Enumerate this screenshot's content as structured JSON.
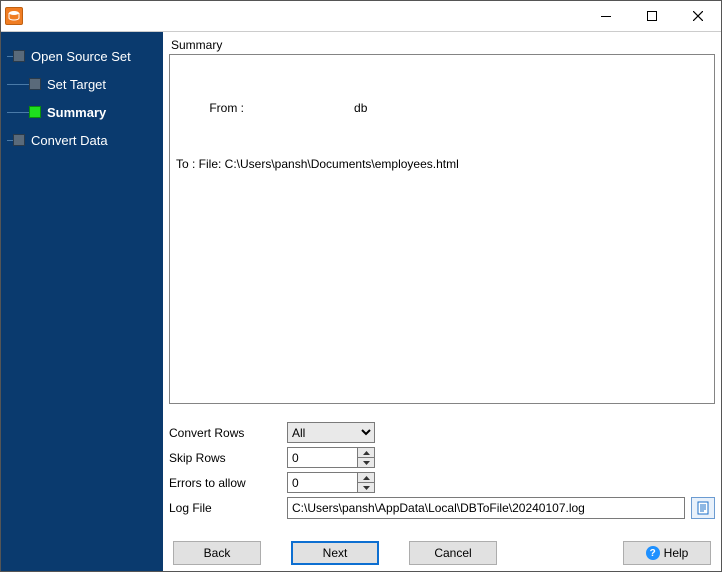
{
  "window": {
    "app_icon": "db-convert-icon"
  },
  "sidebar": {
    "steps": [
      {
        "label": "Open Source Set",
        "indent": "root",
        "current": false
      },
      {
        "label": "Set Target",
        "indent": "indent",
        "current": false
      },
      {
        "label": "Summary",
        "indent": "indent",
        "current": true
      },
      {
        "label": "Convert Data",
        "indent": "root",
        "current": false
      }
    ]
  },
  "summary": {
    "title": "Summary",
    "from_label": "From :",
    "from_value": "db",
    "to_line": "To : File: C:\\Users\\pansh\\Documents\\employees.html"
  },
  "form": {
    "convert_rows": {
      "label": "Convert Rows",
      "value": "All",
      "options": [
        "All"
      ]
    },
    "skip_rows": {
      "label": "Skip Rows",
      "value": "0"
    },
    "errors_allow": {
      "label": "Errors to allow",
      "value": "0"
    },
    "log_file": {
      "label": "Log File",
      "value": "C:\\Users\\pansh\\AppData\\Local\\DBToFile\\20240107.log"
    }
  },
  "nav": {
    "back": "Back",
    "next": "Next",
    "cancel": "Cancel",
    "help": "Help"
  }
}
